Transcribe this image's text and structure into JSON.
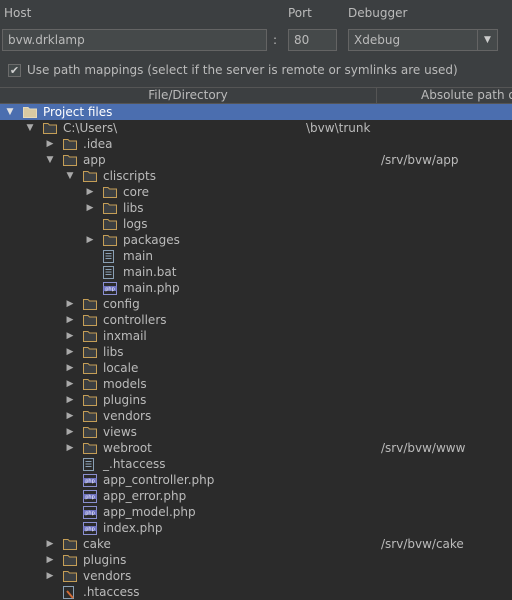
{
  "host": {
    "label": "Host",
    "value": "bvw.drklamp"
  },
  "port": {
    "label": "Port",
    "value": "80"
  },
  "debugger": {
    "label": "Debugger",
    "value": "Xdebug"
  },
  "path_mappings": {
    "checked": true,
    "label": "Use path mappings (select if the server is remote or symlinks are used)"
  },
  "table": {
    "columns": [
      "File/Directory",
      "Absolute path on"
    ],
    "rows": [
      {
        "name": "Project files",
        "depth": 0,
        "type": "project",
        "toggle": "expanded",
        "selected": true
      },
      {
        "name": "C:\\Users\\",
        "depth": 1,
        "type": "folder",
        "toggle": "expanded",
        "mid": "\\bvw\\trunk"
      },
      {
        "name": ".idea",
        "depth": 2,
        "type": "folder",
        "toggle": "collapsed"
      },
      {
        "name": "app",
        "depth": 2,
        "type": "folder",
        "toggle": "expanded",
        "path": "/srv/bvw/app"
      },
      {
        "name": "cliscripts",
        "depth": 3,
        "type": "folder",
        "toggle": "expanded"
      },
      {
        "name": "core",
        "depth": 4,
        "type": "folder",
        "toggle": "collapsed"
      },
      {
        "name": "libs",
        "depth": 4,
        "type": "folder",
        "toggle": "collapsed"
      },
      {
        "name": "logs",
        "depth": 4,
        "type": "folder",
        "toggle": "none"
      },
      {
        "name": "packages",
        "depth": 4,
        "type": "folder",
        "toggle": "collapsed"
      },
      {
        "name": "main",
        "depth": 4,
        "type": "text",
        "toggle": "none"
      },
      {
        "name": "main.bat",
        "depth": 4,
        "type": "text",
        "toggle": "none"
      },
      {
        "name": "main.php",
        "depth": 4,
        "type": "php",
        "toggle": "none"
      },
      {
        "name": "config",
        "depth": 3,
        "type": "folder",
        "toggle": "collapsed"
      },
      {
        "name": "controllers",
        "depth": 3,
        "type": "folder",
        "toggle": "collapsed"
      },
      {
        "name": "inxmail",
        "depth": 3,
        "type": "folder",
        "toggle": "collapsed"
      },
      {
        "name": "libs",
        "depth": 3,
        "type": "folder",
        "toggle": "collapsed"
      },
      {
        "name": "locale",
        "depth": 3,
        "type": "folder",
        "toggle": "collapsed"
      },
      {
        "name": "models",
        "depth": 3,
        "type": "folder",
        "toggle": "collapsed"
      },
      {
        "name": "plugins",
        "depth": 3,
        "type": "folder",
        "toggle": "collapsed"
      },
      {
        "name": "vendors",
        "depth": 3,
        "type": "folder",
        "toggle": "collapsed"
      },
      {
        "name": "views",
        "depth": 3,
        "type": "folder",
        "toggle": "collapsed"
      },
      {
        "name": "webroot",
        "depth": 3,
        "type": "folder",
        "toggle": "collapsed",
        "path": "/srv/bvw/www"
      },
      {
        "name": "_.htaccess",
        "depth": 3,
        "type": "text",
        "toggle": "none"
      },
      {
        "name": "app_controller.php",
        "depth": 3,
        "type": "php",
        "toggle": "none"
      },
      {
        "name": "app_error.php",
        "depth": 3,
        "type": "php",
        "toggle": "none"
      },
      {
        "name": "app_model.php",
        "depth": 3,
        "type": "php",
        "toggle": "none"
      },
      {
        "name": "index.php",
        "depth": 3,
        "type": "php",
        "toggle": "none"
      },
      {
        "name": "cake",
        "depth": 2,
        "type": "folder",
        "toggle": "collapsed",
        "path": "/srv/bvw/cake"
      },
      {
        "name": "plugins",
        "depth": 2,
        "type": "folder",
        "toggle": "collapsed"
      },
      {
        "name": "vendors",
        "depth": 2,
        "type": "folder",
        "toggle": "collapsed"
      },
      {
        "name": ".htaccess",
        "depth": 2,
        "type": "config",
        "toggle": "none"
      }
    ]
  },
  "colors": {
    "background": "#3c3f41",
    "tree_background": "#2b2b2b",
    "selection": "#4b6eaf",
    "folder": "#c59e56",
    "text": "#bbbbbb"
  }
}
